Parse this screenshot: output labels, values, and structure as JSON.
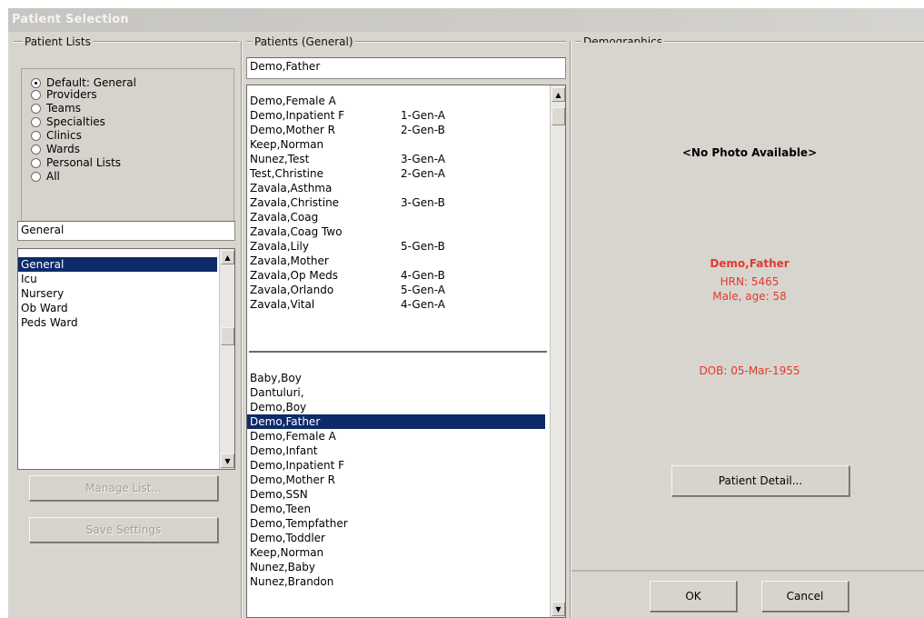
{
  "window": {
    "title": "Patient Selection"
  },
  "patient_lists": {
    "label": "Patient Lists",
    "options": [
      {
        "label": "Default: General",
        "checked": true
      },
      {
        "label": "Providers",
        "checked": false
      },
      {
        "label": "Teams",
        "checked": false
      },
      {
        "label": "Specialties",
        "checked": false
      },
      {
        "label": "Clinics",
        "checked": false
      },
      {
        "label": "Wards",
        "checked": false
      },
      {
        "label": "Personal Lists",
        "checked": false
      },
      {
        "label": "All",
        "checked": false
      }
    ],
    "list_field_value": "General",
    "list_items": [
      {
        "label": "General",
        "selected": true
      },
      {
        "label": "Icu",
        "selected": false
      },
      {
        "label": "Nursery",
        "selected": false
      },
      {
        "label": "Ob Ward",
        "selected": false
      },
      {
        "label": "Peds Ward",
        "selected": false
      }
    ],
    "manage_list_label": "Manage List...",
    "save_settings_label": "Save Settings"
  },
  "patients": {
    "label": "Patients (General)",
    "search_value": "Demo,Father",
    "top_list": [
      {
        "name": "Demo,Female A",
        "code": ""
      },
      {
        "name": "Demo,Inpatient F",
        "code": "1-Gen-A"
      },
      {
        "name": "Demo,Mother R",
        "code": "2-Gen-B"
      },
      {
        "name": "Keep,Norman",
        "code": ""
      },
      {
        "name": "Nunez,Test",
        "code": "3-Gen-A"
      },
      {
        "name": "Test,Christine",
        "code": "2-Gen-A"
      },
      {
        "name": "Zavala,Asthma",
        "code": ""
      },
      {
        "name": "Zavala,Christine",
        "code": "3-Gen-B"
      },
      {
        "name": "Zavala,Coag",
        "code": ""
      },
      {
        "name": "Zavala,Coag Two",
        "code": ""
      },
      {
        "name": "Zavala,Lily",
        "code": "5-Gen-B"
      },
      {
        "name": "Zavala,Mother",
        "code": ""
      },
      {
        "name": "Zavala,Op Meds",
        "code": "4-Gen-B"
      },
      {
        "name": "Zavala,Orlando",
        "code": "5-Gen-A"
      },
      {
        "name": "Zavala,Vital",
        "code": "4-Gen-A"
      }
    ],
    "bottom_list": [
      {
        "name": "Baby,Boy",
        "selected": false
      },
      {
        "name": "Dantuluri,",
        "selected": false
      },
      {
        "name": "Demo,Boy",
        "selected": false
      },
      {
        "name": "Demo,Father",
        "selected": true
      },
      {
        "name": "Demo,Female A",
        "selected": false
      },
      {
        "name": "Demo,Infant",
        "selected": false
      },
      {
        "name": "Demo,Inpatient F",
        "selected": false
      },
      {
        "name": "Demo,Mother R",
        "selected": false
      },
      {
        "name": "Demo,SSN",
        "selected": false
      },
      {
        "name": "Demo,Teen",
        "selected": false
      },
      {
        "name": "Demo,Tempfather",
        "selected": false
      },
      {
        "name": "Demo,Toddler",
        "selected": false
      },
      {
        "name": "Keep,Norman",
        "selected": false
      },
      {
        "name": "Nunez,Baby",
        "selected": false
      },
      {
        "name": "Nunez,Brandon",
        "selected": false
      }
    ]
  },
  "demographics": {
    "label": "Demographics",
    "photo_text": "<No Photo Available>",
    "patient_name": "Demo,Father",
    "hrn": "HRN: 5465",
    "sex_age": "Male, age: 58",
    "dob": "DOB: 05-Mar-1955",
    "detail_button_label": "Patient Detail...",
    "accent_color": "#e13a2e"
  },
  "actions": {
    "ok_label": "OK",
    "cancel_label": "Cancel"
  }
}
